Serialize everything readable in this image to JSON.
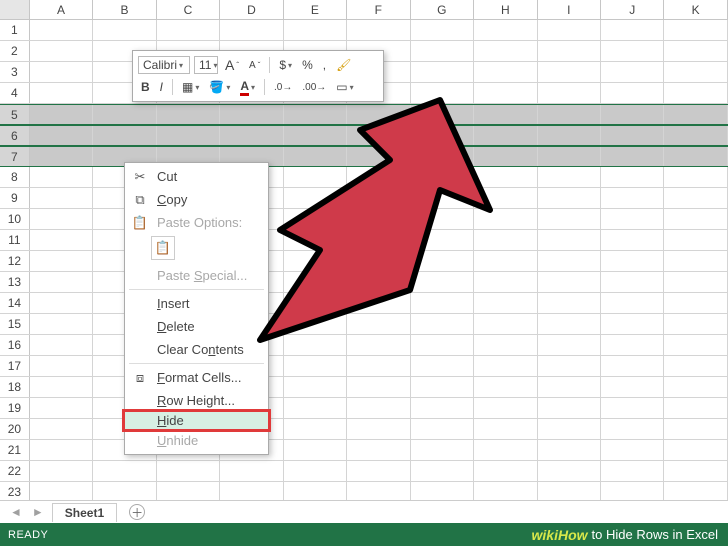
{
  "columns": [
    "A",
    "B",
    "C",
    "D",
    "E",
    "F",
    "G",
    "H",
    "I",
    "J",
    "K"
  ],
  "rows": [
    "1",
    "2",
    "3",
    "4",
    "5",
    "6",
    "7",
    "8",
    "9",
    "10",
    "11",
    "12",
    "13",
    "14",
    "15",
    "16",
    "17",
    "18",
    "19",
    "20",
    "21",
    "22",
    "23"
  ],
  "selected_rows": [
    "5",
    "6",
    "7"
  ],
  "mini_toolbar": {
    "font_name": "Calibri",
    "font_size": "11",
    "grow_font": "A",
    "shrink_font": "A",
    "currency": "$",
    "percent": "%",
    "comma": ",",
    "bold": "B",
    "italic": "I"
  },
  "context_menu": {
    "cut": "Cut",
    "copy": "Copy",
    "paste_options": "Paste Options:",
    "paste_special": "Paste Special...",
    "insert": "Insert",
    "delete": "Delete",
    "clear_contents": "Clear Contents",
    "format_cells": "Format Cells...",
    "row_height": "Row Height...",
    "hide": "Hide",
    "unhide": "Unhide"
  },
  "sheet_tabs": {
    "tab1": "Sheet1"
  },
  "status": {
    "ready": "READY"
  },
  "caption": {
    "brand": "wikiHow",
    "text": " to Hide Rows in Excel"
  }
}
